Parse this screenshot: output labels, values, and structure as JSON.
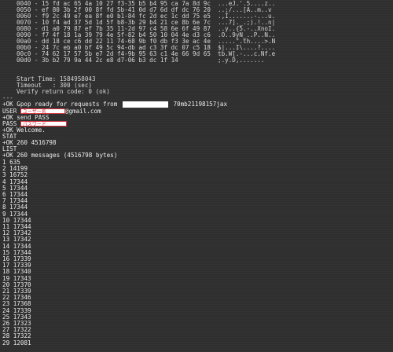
{
  "hexdump": [
    {
      "off": "0040",
      "hex": "15 fd ac 65 4a 10 27 f3-35 b5 b4 95 ca 7a 8d 9c",
      "ascii": "...eJ.'.5....z.."
    },
    {
      "off": "0050",
      "hex": "ef 80 3b 2f 00 8f fd 5b-41 0d d7 6d df dc 76 20",
      "ascii": "..;/...[A..m..v "
    },
    {
      "off": "0060",
      "hex": "f9 2c 49 e7 ea 8f e0 b1-84 fc 2d ec 1c dd 75 e5",
      "ascii": ".,I.......-...u."
    },
    {
      "off": "0070",
      "hex": "10 f4 ad 37 5d 1d 5f b8-3b 29 b4 21 ce 8b 6e 7c",
      "ascii": "...7]._.;).!..n|"
    },
    {
      "off": "0080",
      "hex": "d1 a0 79 87 ef 7b 35 11-2d 97 c4 58 6e 6f 49 87",
      "ascii": "..y..{5.-..XnoI."
    },
    {
      "off": "0090",
      "hex": "f7 4f 18 1a 39 79 4e 5f-82 b4 50 10 04 4e d3 c6",
      "ascii": ".O..9yN_..P..N.."
    },
    {
      "off": "00a0",
      "hex": "dd 18 ce c6 dd 22 11 74-68 9b f0 db f3 3e ac 4e",
      "ascii": ".....\".th....>.N"
    },
    {
      "off": "00b0",
      "hex": "24 7c eb a0 bf 49 5c 94-db ad c3 3f dc 07 c5 18",
      "ascii": "$|...I\\....?...."
    },
    {
      "off": "00c0",
      "hex": "74 62 17 57 5b e7 2d f4-9b 95 63 c1 4e 66 9d 65",
      "ascii": "tb.W[.-...c.Nf.e"
    },
    {
      "off": "00d0",
      "hex": "3b b2 79 9a 44 2c e8 d7-06 b3 dc 1f 14",
      "ascii": ";.y.D,......."
    }
  ],
  "session": {
    "start_time": "Start Time: 1584958043",
    "timeout": "Timeout   : 300 (sec)",
    "verify": "Verify return code: 0 (ok)",
    "separator": "---"
  },
  "pop": {
    "ready_prefix": "+OK Gpop ready for requests from",
    "ready_suffix": "70mb21198157jax",
    "user_cmd": "USER",
    "user_box_text": "ユーザー名",
    "user_domain": "@gmail.com",
    "send_pass": "+OK send PASS",
    "pass_cmd": "PASS",
    "pass_box_text": "パスワード",
    "welcome": "+OK Welcome.",
    "stat_cmd": "STAT",
    "stat_resp": "+OK 260 4516798",
    "list_cmd": "LIST",
    "list_resp": "+OK 260 messages (4516798 bytes)"
  },
  "messages": [
    {
      "n": "1",
      "size": "635"
    },
    {
      "n": "2",
      "size": "14199"
    },
    {
      "n": "3",
      "size": "16752"
    },
    {
      "n": "4",
      "size": "17344"
    },
    {
      "n": "5",
      "size": "17344"
    },
    {
      "n": "6",
      "size": "17344"
    },
    {
      "n": "7",
      "size": "17344"
    },
    {
      "n": "8",
      "size": "17344"
    },
    {
      "n": "9",
      "size": "17344"
    },
    {
      "n": "10",
      "size": "17344"
    },
    {
      "n": "11",
      "size": "17344"
    },
    {
      "n": "12",
      "size": "17342"
    },
    {
      "n": "13",
      "size": "17342"
    },
    {
      "n": "14",
      "size": "17344"
    },
    {
      "n": "15",
      "size": "17344"
    },
    {
      "n": "16",
      "size": "17339"
    },
    {
      "n": "17",
      "size": "17339"
    },
    {
      "n": "18",
      "size": "17340"
    },
    {
      "n": "19",
      "size": "17343"
    },
    {
      "n": "20",
      "size": "17370"
    },
    {
      "n": "21",
      "size": "17339"
    },
    {
      "n": "22",
      "size": "17346"
    },
    {
      "n": "23",
      "size": "17368"
    },
    {
      "n": "24",
      "size": "17339"
    },
    {
      "n": "25",
      "size": "17343"
    },
    {
      "n": "26",
      "size": "17323"
    },
    {
      "n": "27",
      "size": "17322"
    },
    {
      "n": "28",
      "size": "17322"
    },
    {
      "n": "29",
      "size": "12081"
    }
  ],
  "colors": {
    "background": "#2f2f2f",
    "text": "#d6d6d6",
    "redact_border": "#d8323c",
    "redact_fill": "#ffffff"
  }
}
